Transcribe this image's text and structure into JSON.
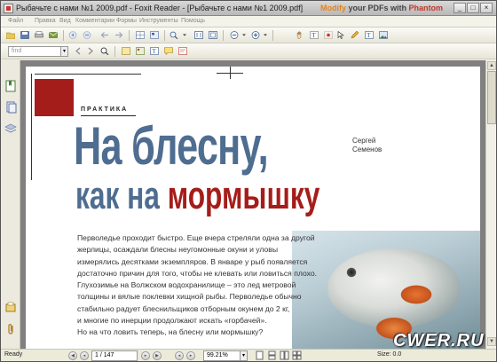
{
  "window": {
    "title": "Рыбачьте с нами №1 2009.pdf - Foxit Reader - [Рыбачьте с нами №1 2009.pdf]",
    "promo_modify": "Modify",
    "promo_middle": " your PDFs with ",
    "promo_brand": "Phantom",
    "min": "_",
    "max": "□",
    "close": "×"
  },
  "menu": [
    "Файл",
    "Правка",
    "Вид",
    "Комментарии",
    "Формы",
    "Инструменты",
    "Помощь"
  ],
  "find": {
    "placeholder": "find",
    "arrow": "▾"
  },
  "document": {
    "kicker": "ПРАКТИКА",
    "author": [
      "Сергей",
      "Семенов"
    ],
    "headline_line1": "На блесну,",
    "headline_line2_prefix": "как на ",
    "headline_line2_highlight": "мормышку",
    "body": [
      "Перволедье проходит быстро. Еще вчера стреляли одна за другой",
      "жерлицы, осаждали блесны неугомонные окуни и уловы",
      "измерялись десятками экземпляров. В январе у рыб появляется",
      "достаточно причин для того, чтобы не клевать или ловиться плохо.",
      "Глухозимье на Волжском водохранилище – это лед метровой",
      "толщины и вялые поклевки хищной рыбы. Перволедье обычно",
      "стабильно радует блеснильщиков отборным окунем до 2 кг,",
      "и многие по инерции продолжают искать «горбачей».",
      "Но на что ловить теперь, на блесну или мормышку?"
    ]
  },
  "statusbar": {
    "ready": "Ready",
    "page": "1 / 147",
    "zoom": "99.21%",
    "zoom_arrow": "▾",
    "size": "Size: 0.0"
  },
  "watermark": "CWER.RU",
  "colors": {
    "headline_blue": "#4f6d90",
    "accent_red": "#a51d1a"
  }
}
